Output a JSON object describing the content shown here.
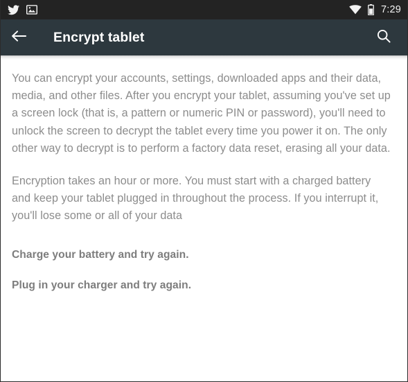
{
  "status_bar": {
    "left_icons": [
      {
        "name": "twitter-icon",
        "label": "Twitter notification"
      },
      {
        "name": "image-icon",
        "label": "Screenshot captured"
      }
    ],
    "right_icons": [
      {
        "name": "wifi-icon",
        "label": "Wi-Fi connected"
      },
      {
        "name": "battery-icon",
        "label": "Battery"
      }
    ],
    "time": "7:29",
    "background_color": "#232323",
    "icon_color": "#f2f2f2"
  },
  "toolbar": {
    "back_icon": "arrow-back-icon",
    "title": "Encrypt tablet",
    "search_icon": "search-icon",
    "background_color": "#2d383e",
    "title_color": "#ffffff"
  },
  "content": {
    "paragraphs": [
      "You can encrypt your accounts, settings, downloaded apps and their data, media, and other files. After you encrypt your tablet, assuming you've set up a screen lock (that is, a pattern or numeric PIN or password), you'll need to unlock the screen to decrypt the tablet every time you power it on. The only other way to decrypt is to perform a factory data reset, erasing all your data.",
      "Encryption takes an hour or more. You must start with a charged battery and keep your tablet plugged in throughout the process. If you interrupt it, you'll lose some or all of your data"
    ],
    "warnings": [
      "Charge your battery and try again.",
      "Plug in your charger and try again."
    ],
    "text_color": "#8c8c8c",
    "warning_color": "#7d7d7d",
    "background_color": "#ffffff"
  }
}
